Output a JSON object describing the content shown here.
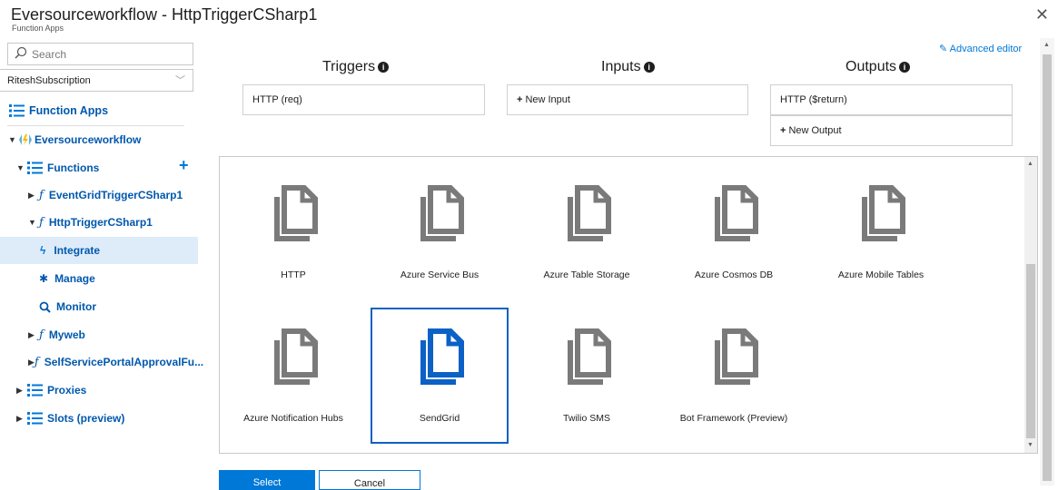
{
  "window": {
    "title": "Eversourceworkflow - HttpTriggerCSharp1",
    "subtitle": "Function Apps",
    "close_glyph": "✕"
  },
  "sidebar": {
    "search_placeholder": "Search",
    "subscription": "RiteshSubscription",
    "function_apps_label": "Function Apps",
    "app_name": "Eversourceworkflow",
    "items": [
      {
        "label": "Functions",
        "type": "section",
        "expanded": true
      },
      {
        "label": "EventGridTriggerCSharp1",
        "type": "function",
        "expanded": false
      },
      {
        "label": "HttpTriggerCSharp1",
        "type": "function",
        "expanded": true
      },
      {
        "label": "Integrate",
        "type": "child",
        "active": true
      },
      {
        "label": "Manage",
        "type": "child"
      },
      {
        "label": "Monitor",
        "type": "child"
      },
      {
        "label": "Myweb",
        "type": "function",
        "expanded": false
      },
      {
        "label": "SelfServicePortalApprovalFu...",
        "type": "function",
        "expanded": false
      },
      {
        "label": "Proxies",
        "type": "section",
        "expanded": false
      },
      {
        "label": "Slots (preview)",
        "type": "section",
        "expanded": false
      }
    ]
  },
  "integrate": {
    "advanced_editor": "Advanced editor",
    "triggers": {
      "title": "Triggers",
      "items": [
        "HTTP (req)"
      ]
    },
    "inputs": {
      "title": "Inputs",
      "new_label": "New Input"
    },
    "outputs": {
      "title": "Outputs",
      "items": [
        "HTTP ($return)"
      ],
      "new_label": "New Output"
    }
  },
  "gallery": {
    "tiles": [
      {
        "label": "HTTP",
        "selected": false
      },
      {
        "label": "Azure Service Bus",
        "selected": false
      },
      {
        "label": "Azure Table Storage",
        "selected": false
      },
      {
        "label": "Azure Cosmos DB",
        "selected": false
      },
      {
        "label": "Azure Mobile Tables",
        "selected": false
      },
      {
        "label": "Azure Notification Hubs",
        "selected": false
      },
      {
        "label": "SendGrid",
        "selected": true
      },
      {
        "label": "Twilio SMS",
        "selected": false
      },
      {
        "label": "Bot Framework (Preview)",
        "selected": false
      }
    ]
  },
  "actions": {
    "select": "Select",
    "cancel": "Cancel"
  },
  "colors": {
    "accent": "#0078d7",
    "selected_icon": "#0b61c5",
    "icon_gray": "#7a7a7a",
    "active_row": "#deecf9"
  }
}
